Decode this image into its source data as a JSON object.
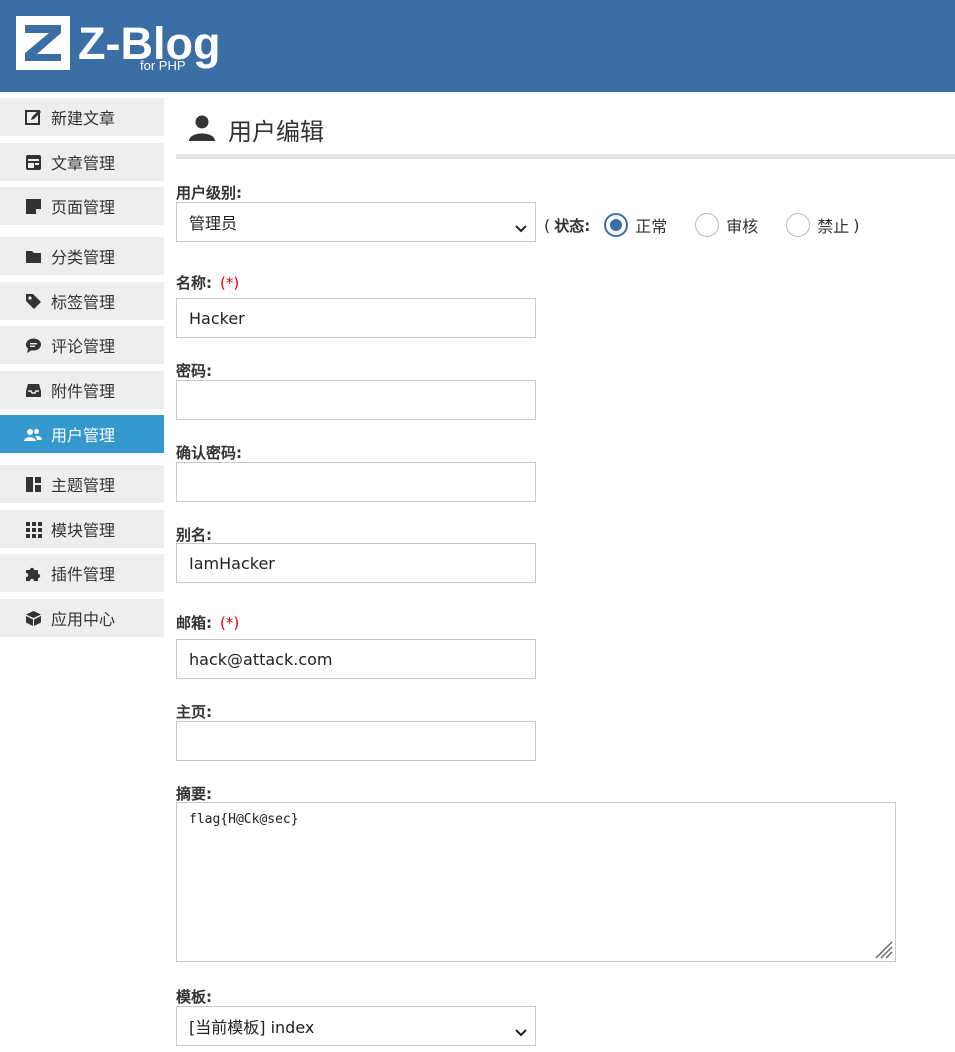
{
  "brand": {
    "name": "Z-Blog",
    "sub": "for PHP"
  },
  "sidebar": {
    "items": [
      {
        "label": "新建文章",
        "icon": "edit-icon"
      },
      {
        "label": "文章管理",
        "icon": "article-list-icon"
      },
      {
        "label": "页面管理",
        "icon": "page-icon"
      },
      {
        "label": "分类管理",
        "icon": "folder-icon"
      },
      {
        "label": "标签管理",
        "icon": "tag-icon"
      },
      {
        "label": "评论管理",
        "icon": "comment-icon"
      },
      {
        "label": "附件管理",
        "icon": "inbox-icon"
      },
      {
        "label": "用户管理",
        "icon": "users-icon",
        "active": true
      },
      {
        "label": "主题管理",
        "icon": "layout-icon"
      },
      {
        "label": "模块管理",
        "icon": "grid-icon"
      },
      {
        "label": "插件管理",
        "icon": "puzzle-icon"
      },
      {
        "label": "应用中心",
        "icon": "box-icon"
      }
    ]
  },
  "page": {
    "title": "用户编辑",
    "icon": "user-icon"
  },
  "form": {
    "level_label": "用户级别:",
    "level_value": "管理员",
    "status": {
      "open": "(",
      "label": "状态:",
      "options": [
        "正常",
        "审核",
        "禁止"
      ],
      "selected": "正常",
      "close": ")"
    },
    "name_label": "名称:",
    "required_mark": "(*)",
    "name_value": "Hacker",
    "password_label": "密码:",
    "password_value": "",
    "confirm_label": "确认密码:",
    "confirm_value": "",
    "alias_label": "别名:",
    "alias_value": "IamHacker",
    "email_label": "邮箱:",
    "email_value": "hack@attack.com",
    "homepage_label": "主页:",
    "homepage_value": "",
    "intro_label": "摘要:",
    "intro_value": "flag{H@Ck@sec}",
    "template_label": "模板:",
    "template_value": "[当前模板] index"
  },
  "colors": {
    "header": "#3a6ea5",
    "active": "#3399cc",
    "required": "#e00000"
  }
}
